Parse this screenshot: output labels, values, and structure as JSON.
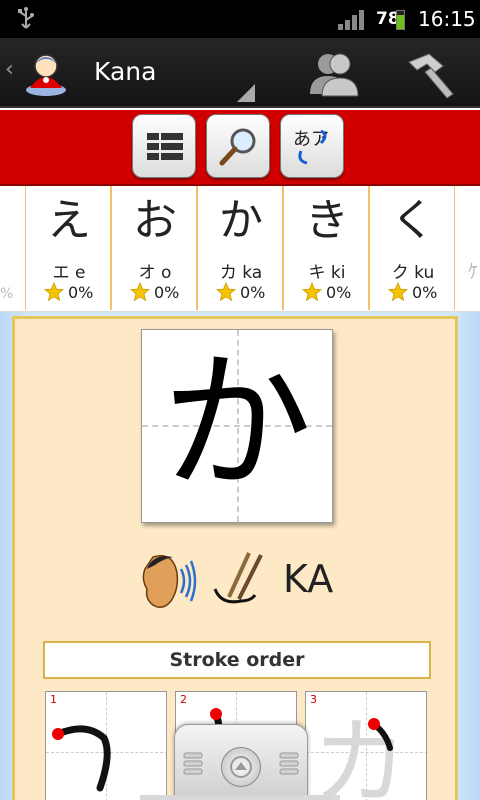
{
  "status_bar": {
    "battery_level": "78",
    "battery_fraction": 0.78,
    "time": "16:15",
    "icons": [
      "usb-icon",
      "signal-icon",
      "battery-icon"
    ]
  },
  "action_bar": {
    "title": "Kana",
    "icons": [
      "app-logo-icon",
      "users-icon",
      "hammer-icon"
    ]
  },
  "toolbar": {
    "buttons": [
      "grid-view-icon",
      "search-icon",
      "kana-switch-icon"
    ],
    "kana_switch_glyphs": "あア"
  },
  "kana_strip": {
    "left_peek": "%",
    "right_peek": "ｹ",
    "items": [
      {
        "hiragana": "え",
        "katakana": "エ",
        "romaji": "e",
        "score": "0%"
      },
      {
        "hiragana": "お",
        "katakana": "オ",
        "romaji": "o",
        "score": "0%"
      },
      {
        "hiragana": "か",
        "katakana": "カ",
        "romaji": "ka",
        "score": "0%"
      },
      {
        "hiragana": "き",
        "katakana": "キ",
        "romaji": "ki",
        "score": "0%"
      },
      {
        "hiragana": "く",
        "katakana": "ク",
        "romaji": "ku",
        "score": "0%"
      }
    ]
  },
  "detail": {
    "character": "か",
    "romaji": "KA",
    "stroke_order_label": "Stroke order",
    "stroke_steps": [
      "1",
      "2",
      "3"
    ],
    "faded_character": "カ"
  },
  "colors": {
    "accent_red": "#d10000",
    "panel_bg": "#fde9c6",
    "panel_border": "#e6c65a",
    "star": "#f5c400"
  }
}
